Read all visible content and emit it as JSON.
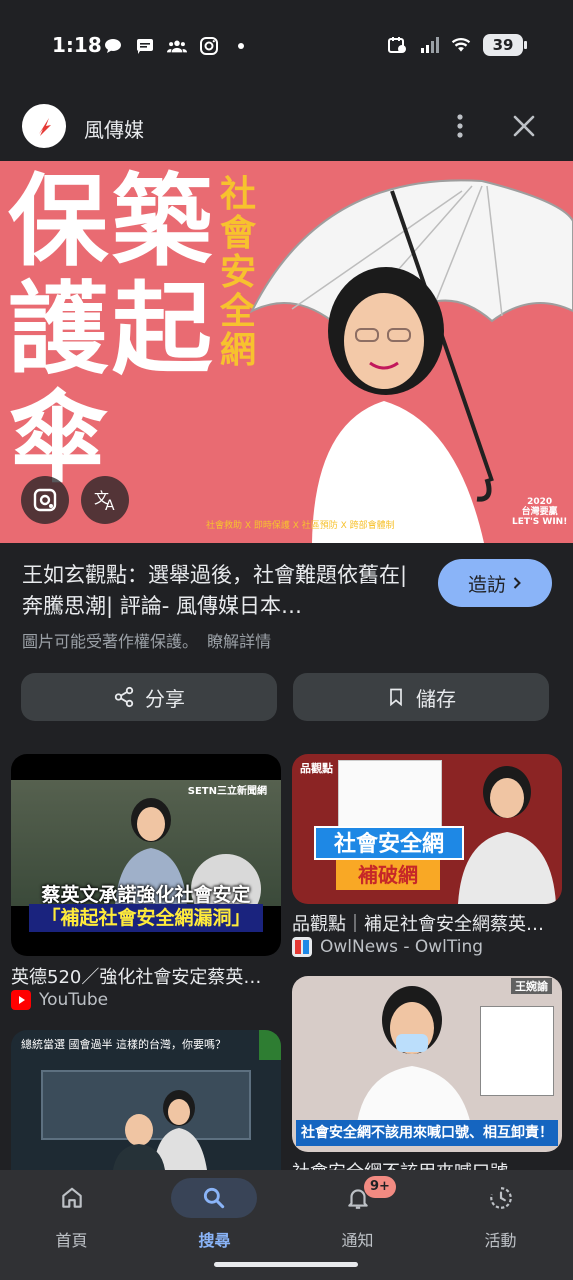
{
  "status_bar": {
    "time": "1:18",
    "battery": "39"
  },
  "header": {
    "site_name": "風傳媒"
  },
  "main_image": {
    "big_text_col1": [
      "保",
      "護",
      "傘"
    ],
    "big_text_col2": [
      "築",
      "起"
    ],
    "yellow_text": [
      "社",
      "會",
      "安",
      "全",
      "網"
    ],
    "footer_text": "社會救助 X 即時保護 X 社區預防 X 跨部會體制",
    "logo_line1": "2020",
    "logo_line2": "台灣要贏",
    "logo_line3": "LET'S WIN!"
  },
  "result": {
    "title": "王如玄觀點：選舉過後，社會難題依舊在| 奔騰思潮| 評論- 風傳媒日本…",
    "visit_label": "造訪",
    "copyright_text": "圖片可能受著作權保護。",
    "learn_more": "瞭解詳情",
    "share_label": "分享",
    "save_label": "儲存"
  },
  "grid": [
    {
      "caption_line1": "蔡英文承諾強化社會安定",
      "caption_line2": "「補起社會安全網漏洞」",
      "channel_tag": "SETN三立新聞網",
      "title": "英德520／強化社會安定蔡英…",
      "source": "YouTube"
    },
    {
      "caption_line1": "社會安全網",
      "caption_line2": "補破網",
      "channel_tag": "品觀點",
      "title": "品觀點｜補足社會安全網蔡英…",
      "source": "OwlNews - OwlTing"
    },
    {
      "banner_text": "總統當選 國會過半 這樣的台灣，你要嗎？",
      "title": "",
      "source": ""
    },
    {
      "caption_line1": "社會安全網不該用來喊口號、相互卸責！",
      "channel_tag": "王婉諭",
      "title": "社會安全網不該用來喊口號…",
      "source": ""
    }
  ],
  "bottom_nav": [
    {
      "label": "首頁",
      "icon": "home-icon"
    },
    {
      "label": "搜尋",
      "icon": "search-icon"
    },
    {
      "label": "通知",
      "icon": "bell-icon",
      "badge": "9+"
    },
    {
      "label": "活動",
      "icon": "activity-icon"
    }
  ],
  "colors": {
    "accent": "#8ab4f8",
    "image_bg": "#e96b72",
    "highlight": "#f7c22e",
    "badge": "#f28b82"
  }
}
